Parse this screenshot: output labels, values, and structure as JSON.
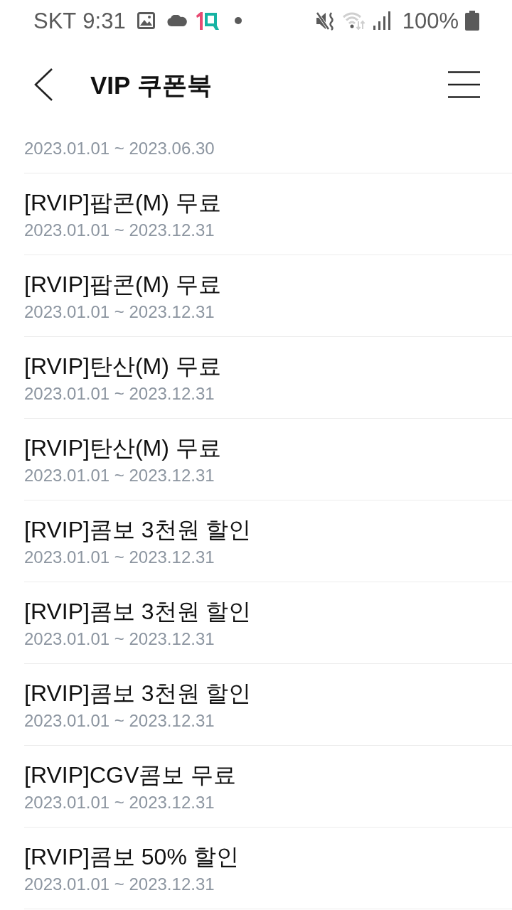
{
  "status_bar": {
    "carrier": "SKT",
    "time": "9:31",
    "battery": "100%"
  },
  "header": {
    "title": "VIP 쿠폰북"
  },
  "coupons": [
    {
      "period": "2023.01.01 ~ 2023.06.30"
    },
    {
      "title": "[RVIP]팝콘(M) 무료",
      "period": "2023.01.01 ~ 2023.12.31"
    },
    {
      "title": "[RVIP]팝콘(M) 무료",
      "period": "2023.01.01 ~ 2023.12.31"
    },
    {
      "title": "[RVIP]탄산(M) 무료",
      "period": "2023.01.01 ~ 2023.12.31"
    },
    {
      "title": "[RVIP]탄산(M) 무료",
      "period": "2023.01.01 ~ 2023.12.31"
    },
    {
      "title": "[RVIP]콤보 3천원 할인",
      "period": "2023.01.01 ~ 2023.12.31"
    },
    {
      "title": "[RVIP]콤보 3천원 할인",
      "period": "2023.01.01 ~ 2023.12.31"
    },
    {
      "title": "[RVIP]콤보 3천원 할인",
      "period": "2023.01.01 ~ 2023.12.31"
    },
    {
      "title": "[RVIP]CGV콤보 무료",
      "period": "2023.01.01 ~ 2023.12.31"
    },
    {
      "title": "[RVIP]콤보 50% 할인",
      "period": "2023.01.01 ~ 2023.12.31"
    }
  ]
}
